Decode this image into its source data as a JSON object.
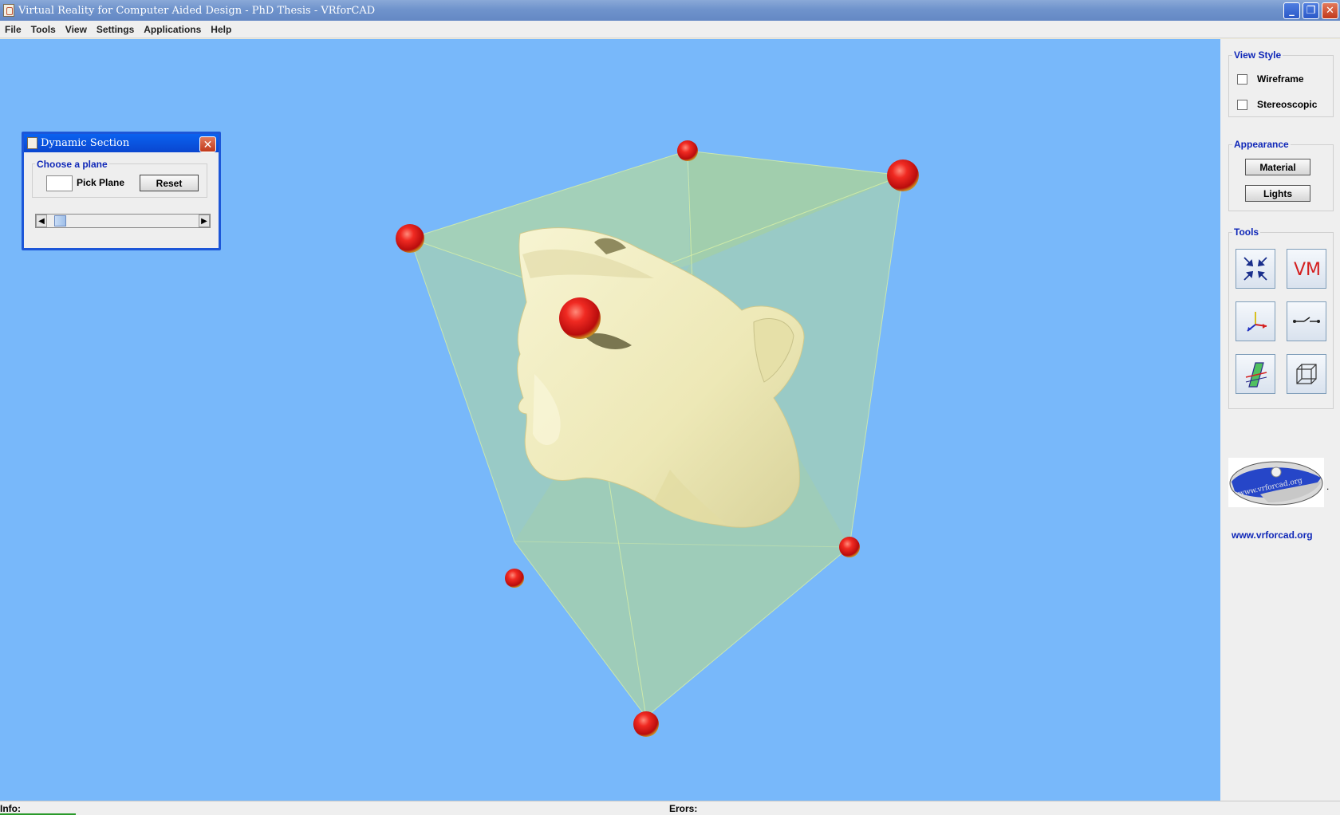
{
  "window": {
    "title": "Virtual Reality for Computer Aided Design - PhD Thesis  - VRforCAD",
    "buttons": {
      "minimize": "_",
      "maximize": "❐",
      "close": "✕"
    }
  },
  "menu": [
    "File",
    "Tools",
    "View",
    "Settings",
    "Applications",
    "Help"
  ],
  "dialog": {
    "title": "Dynamic Section",
    "group_label": "Choose a plane",
    "pick_label": "Pick Plane",
    "reset_label": "Reset",
    "slider_position": 0.05
  },
  "sidepanel": {
    "view_style": {
      "label": "View Style",
      "wireframe": "Wireframe",
      "wireframe_checked": false,
      "stereoscopic": "Stereoscopic",
      "stereoscopic_checked": false
    },
    "appearance": {
      "label": "Appearance",
      "material": "Material",
      "lights": "Lights"
    },
    "tools": {
      "label": "Tools",
      "icons": [
        "fit-all-icon",
        "vm-icon",
        "axes-icon",
        "measure-icon",
        "section-plane-icon",
        "bounding-box-icon"
      ],
      "vm_text": "VM"
    },
    "logo_text": "www.vrforcad.org",
    "logo_suffix": ".",
    "site": "www.vrforcad.org"
  },
  "status": {
    "info": "Info:",
    "errors": "Erors:"
  },
  "colors": {
    "viewport_bg": "#78b8fa",
    "box_fill": "#b4d99a",
    "sphere": "#e81c1c",
    "model": "#f2eec0",
    "accent": "#1028b8"
  }
}
